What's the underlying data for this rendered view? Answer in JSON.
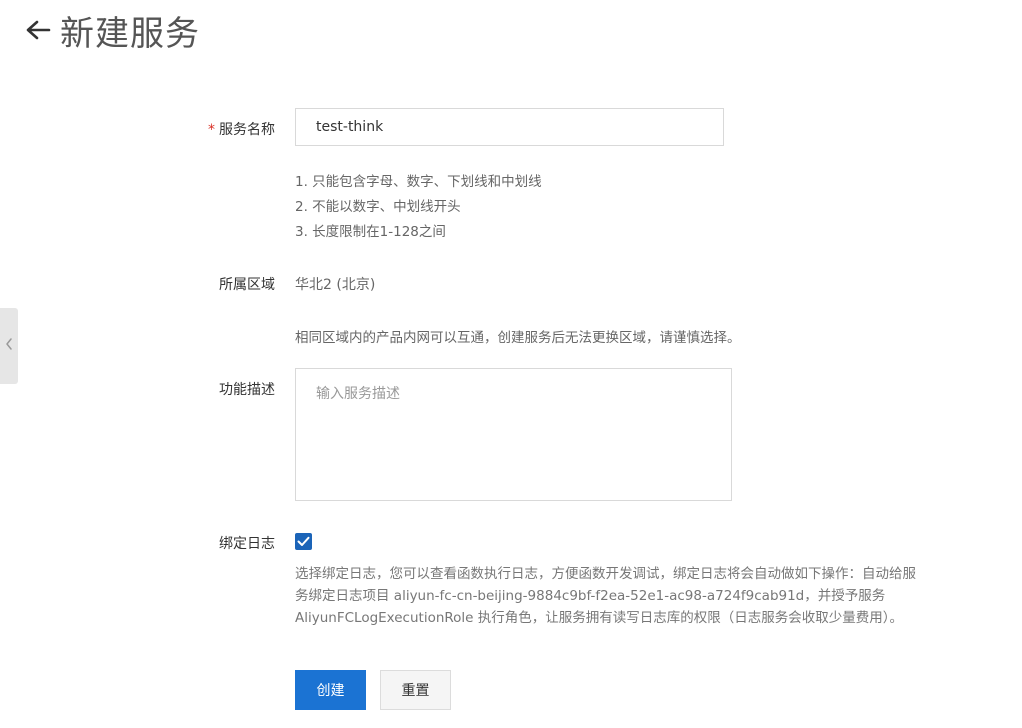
{
  "header": {
    "title": "新建服务",
    "back_icon": "arrow-left-icon"
  },
  "form": {
    "service_name": {
      "required_mark": "*",
      "label": "服务名称",
      "value": "test-think"
    },
    "rules": [
      "1. 只能包含字母、数字、下划线和中划线",
      "2. 不能以数字、中划线开头",
      "3. 长度限制在1-128之间"
    ],
    "region": {
      "label": "所属区域",
      "value": "华北2 (北京)",
      "note": "相同区域内的产品内网可以互通，创建服务后无法更换区域，请谨慎选择。"
    },
    "description": {
      "label": "功能描述",
      "placeholder": "输入服务描述",
      "value": ""
    },
    "bind_log": {
      "label": "绑定日志",
      "checked": true,
      "description": "选择绑定日志，您可以查看函数执行日志，方便函数开发调试，绑定日志将会自动做如下操作：自动给服务绑定日志项目 aliyun-fc-cn-beijing-9884c9bf-f2ea-52e1-ac98-a724f9cab91d，并授予服务 AliyunFCLogExecutionRole 执行角色，让服务拥有读写日志库的权限（日志服务会收取少量费用）。"
    }
  },
  "actions": {
    "create_label": "创建",
    "reset_label": "重置"
  },
  "colors": {
    "primary": "#1b73d3",
    "checkbox": "#1b64b8",
    "required": "#d93026"
  }
}
